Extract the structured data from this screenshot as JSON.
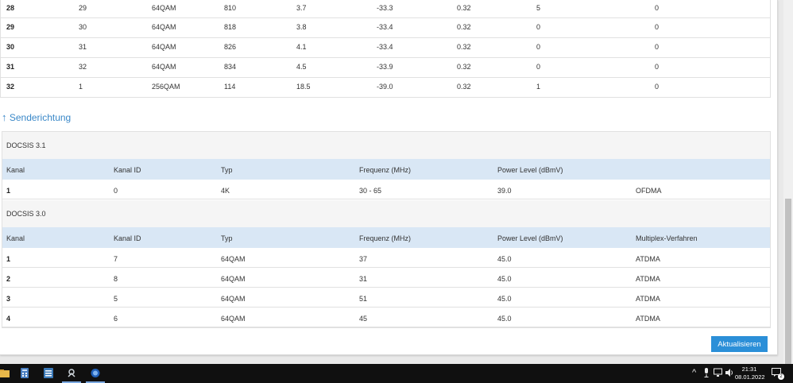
{
  "downstream_rows": [
    [
      "28",
      "29",
      "64QAM",
      "810",
      "3.7",
      "-33.3",
      "0.32",
      "5",
      "0"
    ],
    [
      "29",
      "30",
      "64QAM",
      "818",
      "3.8",
      "-33.4",
      "0.32",
      "0",
      "0"
    ],
    [
      "30",
      "31",
      "64QAM",
      "826",
      "4.1",
      "-33.4",
      "0.32",
      "0",
      "0"
    ],
    [
      "31",
      "32",
      "64QAM",
      "834",
      "4.5",
      "-33.9",
      "0.32",
      "0",
      "0"
    ],
    [
      "32",
      "1",
      "256QAM",
      "114",
      "18.5",
      "-39.0",
      "0.32",
      "1",
      "0"
    ]
  ],
  "upstream": {
    "arrow": "↑",
    "title": "Senderichtung",
    "docsis31": {
      "label": "DOCSIS 3.1",
      "headers": [
        "Kanal",
        "Kanal ID",
        "Typ",
        "Frequenz (MHz)",
        "Power Level (dBmV)",
        ""
      ],
      "rows": [
        [
          "1",
          "0",
          "4K",
          "30 - 65",
          "39.0",
          "OFDMA"
        ]
      ]
    },
    "docsis30": {
      "label": "DOCSIS 3.0",
      "headers": [
        "Kanal",
        "Kanal ID",
        "Typ",
        "Frequenz (MHz)",
        "Power Level (dBmV)",
        "Multiplex-Verfahren"
      ],
      "rows": [
        [
          "1",
          "7",
          "64QAM",
          "37",
          "45.0",
          "ATDMA"
        ],
        [
          "2",
          "8",
          "64QAM",
          "31",
          "45.0",
          "ATDMA"
        ],
        [
          "3",
          "5",
          "64QAM",
          "51",
          "45.0",
          "ATDMA"
        ],
        [
          "4",
          "6",
          "64QAM",
          "45",
          "45.0",
          "ATDMA"
        ]
      ]
    }
  },
  "refresh_label": "Aktualisieren",
  "taskbar": {
    "apps": [
      "folder-icon",
      "calculator-icon",
      "notes-icon",
      "game-icon",
      "browser-icon"
    ],
    "time": "21:31",
    "date": "08.01.2022",
    "notification_count": "2"
  },
  "colors": {
    "accent": "#2b8fd8",
    "header_bg": "#d9e7f5",
    "section_title": "#3a88c8"
  }
}
